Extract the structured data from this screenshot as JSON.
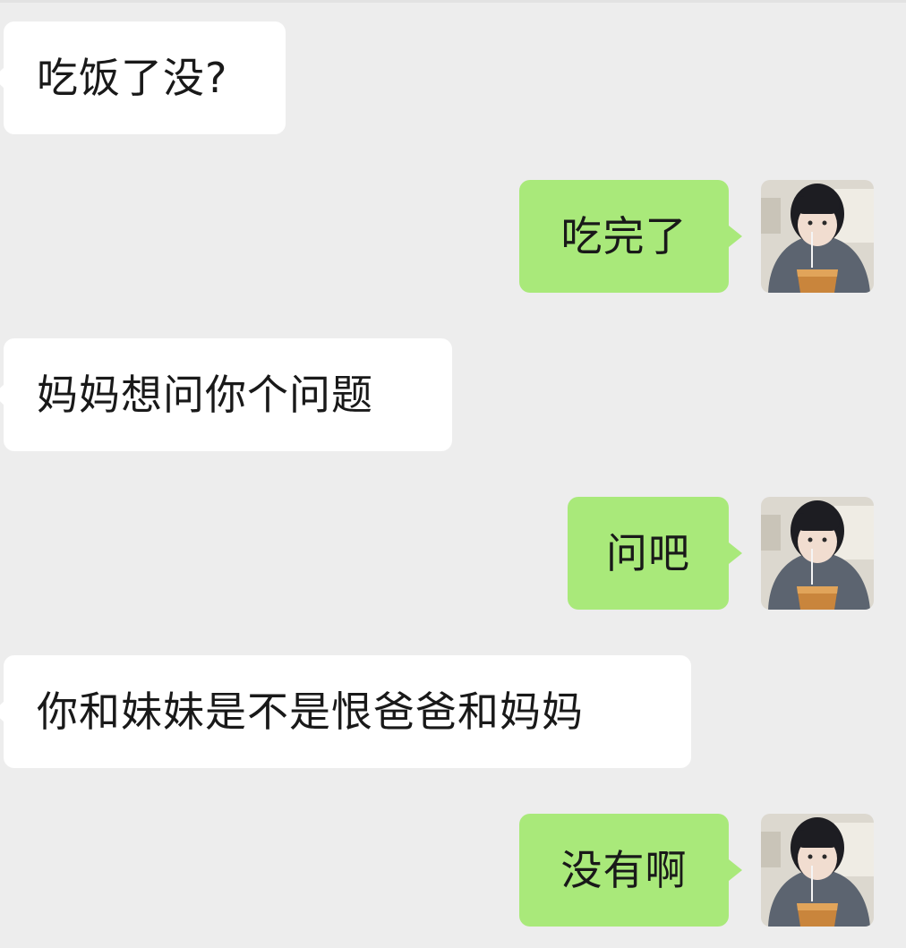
{
  "colors": {
    "background": "#ededed",
    "incoming_bubble": "#ffffff",
    "outgoing_bubble": "#a9e97a",
    "text": "#191919"
  },
  "messages": [
    {
      "direction": "incoming",
      "text": "吃饭了没?"
    },
    {
      "direction": "outgoing",
      "text": "吃完了",
      "avatar_icon": "user-avatar-icon"
    },
    {
      "direction": "incoming",
      "text": "妈妈想问你个问题"
    },
    {
      "direction": "outgoing",
      "text": "问吧",
      "avatar_icon": "user-avatar-icon"
    },
    {
      "direction": "incoming",
      "text": "你和妹妹是不是恨爸爸和妈妈"
    },
    {
      "direction": "outgoing",
      "text": "没有啊",
      "avatar_icon": "user-avatar-icon"
    }
  ]
}
